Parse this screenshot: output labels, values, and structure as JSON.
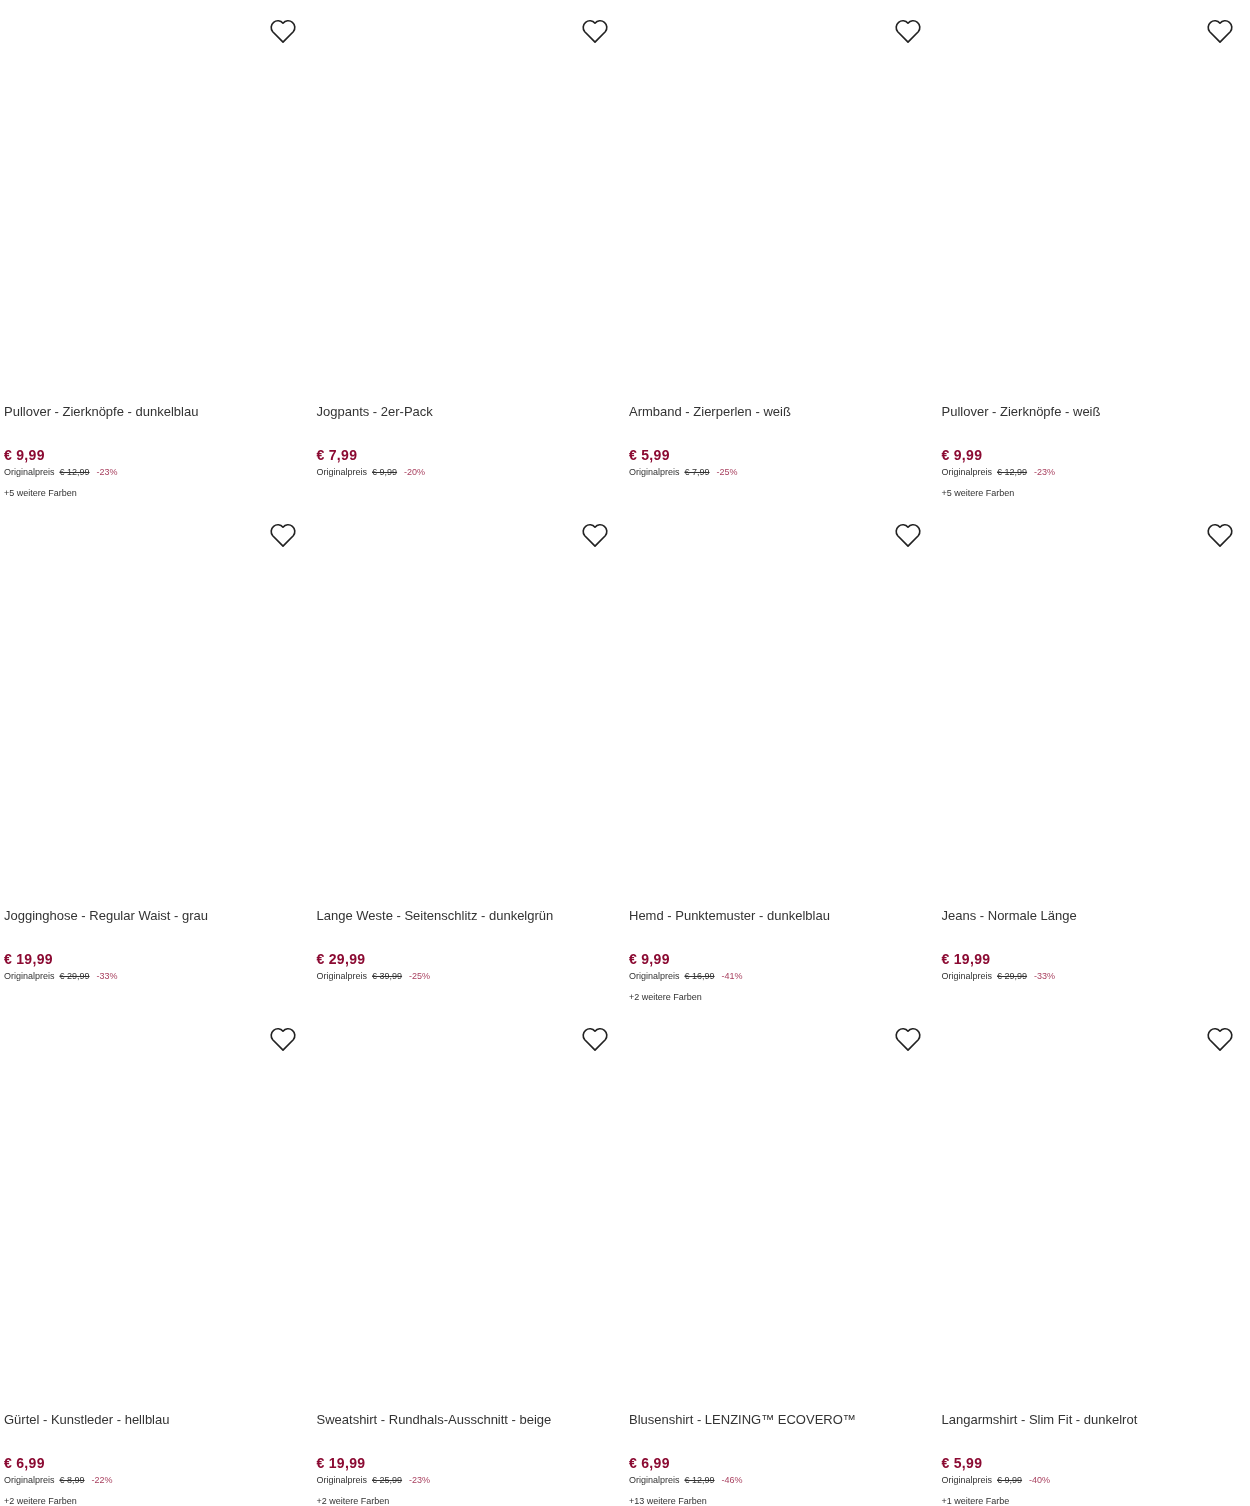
{
  "products": [
    {
      "title": "Pullover - Zierknöpfe - dunkelblau",
      "price": "€ 9,99",
      "original_label": "Originalpreis",
      "original_price": "€ 12,99",
      "discount": "-23%",
      "colors": "+5 weitere Farben",
      "favorite": false
    },
    {
      "title": "Jogpants - 2er-Pack",
      "price": "€ 7,99",
      "original_label": "Originalpreis",
      "original_price": "€ 9,99",
      "discount": "-20%",
      "favorite": false
    },
    {
      "title": "Armband - Zierperlen - weiß",
      "price": "€ 5,99",
      "original_label": "Originalpreis",
      "original_price": "€ 7,99",
      "discount": "-25%",
      "favorite": false
    },
    {
      "title": "Pullover - Zierknöpfe - weiß",
      "price": "€ 9,99",
      "original_label": "Originalpreis",
      "original_price": "€ 12,99",
      "discount": "-23%",
      "colors": "+5 weitere Farben",
      "favorite": false
    },
    {
      "title": "Jogginghose - Regular Waist - grau",
      "price": "€ 19,99",
      "original_label": "Originalpreis",
      "original_price": "€ 29,99",
      "discount": "-33%",
      "favorite": false
    },
    {
      "title": "Lange Weste - Seitenschlitz - dunkelgrün",
      "price": "€ 29,99",
      "original_label": "Originalpreis",
      "original_price": "€ 39,99",
      "discount": "-25%",
      "favorite": false
    },
    {
      "title": "Hemd - Punktemuster - dunkelblau",
      "price": "€ 9,99",
      "original_label": "Originalpreis",
      "original_price": "€ 16,99",
      "discount": "-41%",
      "colors": "+2 weitere Farben",
      "favorite": false
    },
    {
      "title": "Jeans - Normale Länge",
      "price": "€ 19,99",
      "original_label": "Originalpreis",
      "original_price": "€ 29,99",
      "discount": "-33%",
      "favorite": false
    },
    {
      "title": "Gürtel - Kunstleder - hellblau",
      "price": "€ 6,99",
      "original_label": "Originalpreis",
      "original_price": "€ 8,99",
      "discount": "-22%",
      "colors": "+2 weitere Farben",
      "favorite": false
    },
    {
      "title": "Sweatshirt - Rundhals-Ausschnitt - beige",
      "price": "€ 19,99",
      "original_label": "Originalpreis",
      "original_price": "€ 25,99",
      "discount": "-23%",
      "colors": "+2 weitere Farben",
      "favorite": false
    },
    {
      "title": "Blusenshirt - LENZING™ ECOVERO™",
      "price": "€ 6,99",
      "original_label": "Originalpreis",
      "original_price": "€ 12,99",
      "discount": "-46%",
      "colors": "+13 weitere Farben",
      "favorite": false
    },
    {
      "title": "Langarmshirt - Slim Fit - dunkelrot",
      "price": "€ 5,99",
      "original_label": "Originalpreis",
      "original_price": "€ 9,99",
      "discount": "-40%",
      "colors": "+1 weitere Farbe",
      "favorite": false
    }
  ]
}
